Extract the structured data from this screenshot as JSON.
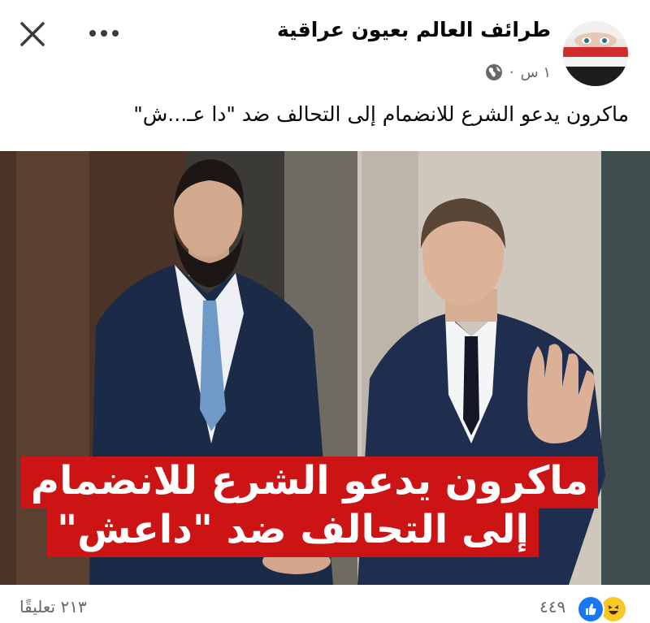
{
  "post": {
    "page_name": "طرائف العالم بعيون عراقية",
    "time": "١ س",
    "separator": "·",
    "caption": "ماكرون يدعو الشرع للانضمام إلى التحالف ضد \"دا عـ...ش\""
  },
  "image": {
    "banner_line1": "ماكرون يدعو الشرع للانضمام",
    "banner_line2": "إلى التحالف ضد \"داعش\"",
    "banner_color": "#cc1414"
  },
  "footer": {
    "reaction_count": "٤٤٩",
    "comments": "٢١٣ تعليقًا",
    "reactions": [
      "haha-icon",
      "like-icon"
    ]
  },
  "icons": {
    "close": "close-icon",
    "more": "more-icon",
    "audience": "globe-icon"
  }
}
